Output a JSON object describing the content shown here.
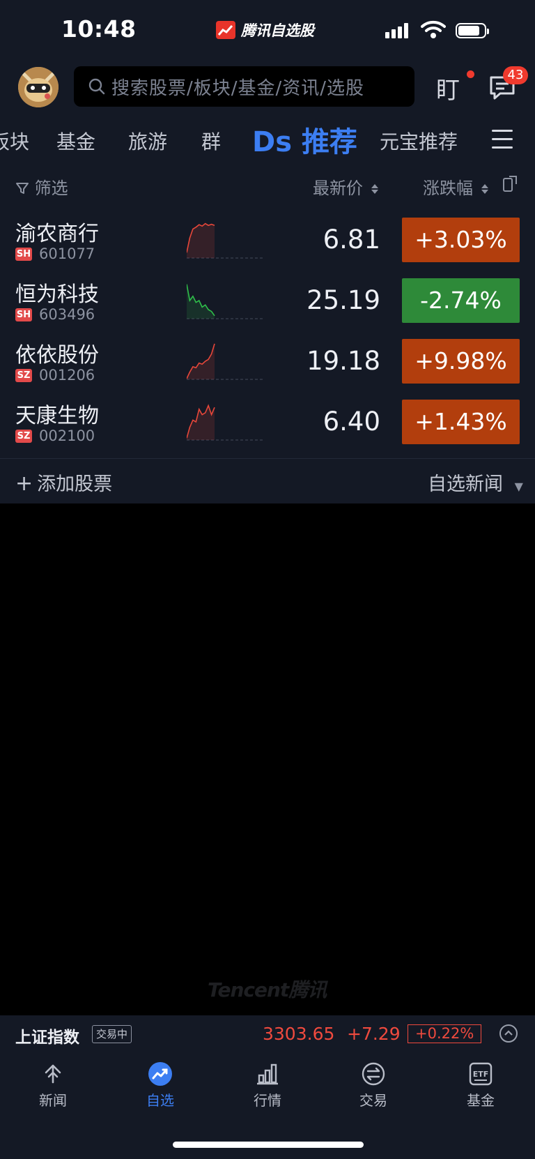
{
  "status_bar": {
    "time": "10:48",
    "app_name": "腾讯自选股"
  },
  "header": {
    "search_placeholder": "搜索股票/板块/基金/资讯/选股",
    "message_badge": "43",
    "watch_icon_label": "盯"
  },
  "tabs": [
    {
      "label": "板块",
      "active": false
    },
    {
      "label": "基金",
      "active": false
    },
    {
      "label": "旅游",
      "active": false
    },
    {
      "label": "群",
      "active": false
    },
    {
      "label": "Ds 推荐",
      "active": true
    },
    {
      "label": "元宝推荐",
      "active": false
    }
  ],
  "table_header": {
    "filter": "筛选",
    "price": "最新价",
    "change": "涨跌幅"
  },
  "stocks": [
    {
      "name": "渝农商行",
      "market": "SH",
      "code": "601077",
      "price": "6.81",
      "change": "+3.03%",
      "direction": "up",
      "spark": [
        0.15,
        0.55,
        0.8,
        0.85,
        0.92,
        0.88,
        0.95,
        0.9,
        0.93,
        0.9
      ]
    },
    {
      "name": "恒为科技",
      "market": "SH",
      "code": "603496",
      "price": "25.19",
      "change": "-2.74%",
      "direction": "down",
      "spark": [
        0.95,
        0.5,
        0.62,
        0.45,
        0.5,
        0.32,
        0.38,
        0.25,
        0.2,
        0.08
      ]
    },
    {
      "name": "依依股份",
      "market": "SZ",
      "code": "001206",
      "price": "19.18",
      "change": "+9.98%",
      "direction": "up",
      "spark": [
        0.02,
        0.2,
        0.35,
        0.32,
        0.45,
        0.42,
        0.5,
        0.55,
        0.7,
        0.98
      ]
    },
    {
      "name": "天康生物",
      "market": "SZ",
      "code": "002100",
      "price": "6.40",
      "change": "+1.43%",
      "direction": "up",
      "spark": [
        0.05,
        0.35,
        0.55,
        0.5,
        0.85,
        0.7,
        0.75,
        0.95,
        0.7,
        0.9
      ]
    }
  ],
  "footer_actions": {
    "add_stock": "添加股票",
    "news": "自选新闻"
  },
  "watermark": "Tencent腾讯",
  "index_bar": {
    "name": "上证指数",
    "status": "交易中",
    "value": "3303.65",
    "change": "+7.29",
    "percent": "+0.22%"
  },
  "bottom_nav": [
    {
      "label": "新闻",
      "icon": "news-icon",
      "active": false
    },
    {
      "label": "自选",
      "icon": "watchlist-icon",
      "active": true
    },
    {
      "label": "行情",
      "icon": "market-icon",
      "active": false
    },
    {
      "label": "交易",
      "icon": "trade-icon",
      "active": false
    },
    {
      "label": "基金",
      "icon": "fund-icon",
      "active": false
    }
  ],
  "colors": {
    "up": "#b23e0d",
    "down": "#2e8a39",
    "accent": "#3c7ef2",
    "index_red": "#f04a3e"
  }
}
